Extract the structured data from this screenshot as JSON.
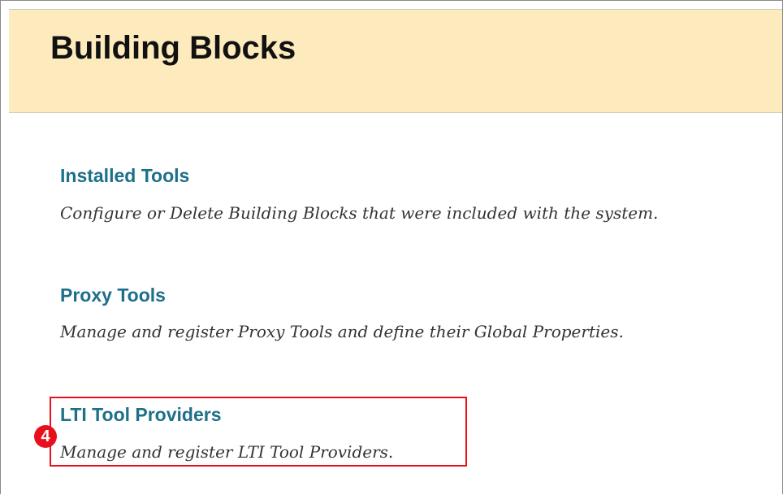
{
  "header": {
    "title": "Building Blocks"
  },
  "tools": [
    {
      "label": "Installed Tools",
      "description": "Configure or Delete Building Blocks that were included with the system."
    },
    {
      "label": "Proxy Tools",
      "description": "Manage and register Proxy Tools and define their Global Properties."
    },
    {
      "label": "LTI Tool Providers",
      "description": "Manage and register LTI Tool Providers."
    }
  ],
  "annotation": {
    "step_number": "4",
    "color": "#e8101c"
  },
  "colors": {
    "header_background": "#fdebbd",
    "link": "#1d6f8a"
  }
}
